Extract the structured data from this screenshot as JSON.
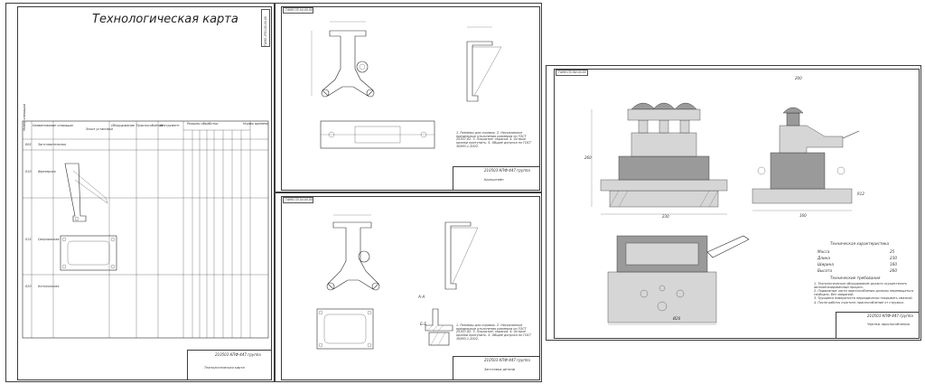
{
  "sheet1": {
    "title": "Технологическая карта",
    "stamp": "ТАМЛ.ЛПО.00.00.00",
    "table_headers": [
      "Номер операции",
      "Наименование операции",
      "Эскиз установки",
      "Оборудование",
      "Приспособление",
      "Инструмент",
      "Режимы обработки",
      "Нормы времени"
    ],
    "rows": [
      {
        "num": "005",
        "name": "Заготовительная"
      },
      {
        "num": "010",
        "name": "Фрезерная"
      },
      {
        "num": "015",
        "name": "Сверлильная"
      },
      {
        "num": "020",
        "name": "Контрольная"
      }
    ],
    "title_block": {
      "code": "210503 КПФ-447 группа",
      "name": "Технологическая карта"
    }
  },
  "sheet2": {
    "stamp": "ТАМЛ.ПЗ.04.00.00",
    "notes": "1. Размеры для справок. 2. Неуказанные предельные отклонения размеров по ГОСТ 25347-82. 3. Покрытие: окраска. 4. Острые кромки притупить. 5. Общие допуски по ГОСТ 30893.1-2002.",
    "title_block": {
      "code": "210503 КПФ-447 группа",
      "name": "Кронштейн"
    }
  },
  "sheet3": {
    "stamp": "ТАМЛ.ПЗ.04.00.00",
    "section_a": "А-А",
    "section_b": "Б-Б",
    "notes": "1. Размеры для справок. 2. Неуказанные предельные отклонения размеров по ГОСТ 25347-82. 3. Покрытие: окраска. 4. Острые кромки притупить. 5. Общие допуски по ГОСТ 30893.1-2002.",
    "title_block": {
      "code": "210503 КПФ-447 группа",
      "name": "Заготовка детали"
    }
  },
  "sheet4": {
    "stamp": "ТАМЛ.ПЗ.ЛИ.00.00",
    "tech_char_title": "Техническая характеристика",
    "tech_chars": [
      {
        "label": "Масса",
        "value": "25"
      },
      {
        "label": "Длина",
        "value": "230"
      },
      {
        "label": "Ширина",
        "value": "160"
      },
      {
        "label": "Высота",
        "value": "260"
      }
    ],
    "tech_req_title": "Технические требования",
    "tech_reqs": [
      "1. Технологическое оборудование должно осуществлять автоматизированный процесс.",
      "2. Подвижные части приспособления должны перемещаться свободно, без заеданий.",
      "3. Трущиеся поверхности периодически покрывать смазкой.",
      "4. После работы очистить приспособление от стружки."
    ],
    "title_block": {
      "code": "210503 КПФ-447 группа",
      "name": "Чертеж приспособления"
    },
    "dims": [
      "200",
      "230",
      "160",
      "260",
      "Ø20",
      "R12"
    ]
  },
  "colors": {
    "line": "#2a2a2a",
    "paper": "#ffffff",
    "shade": "#d6d6d6"
  }
}
